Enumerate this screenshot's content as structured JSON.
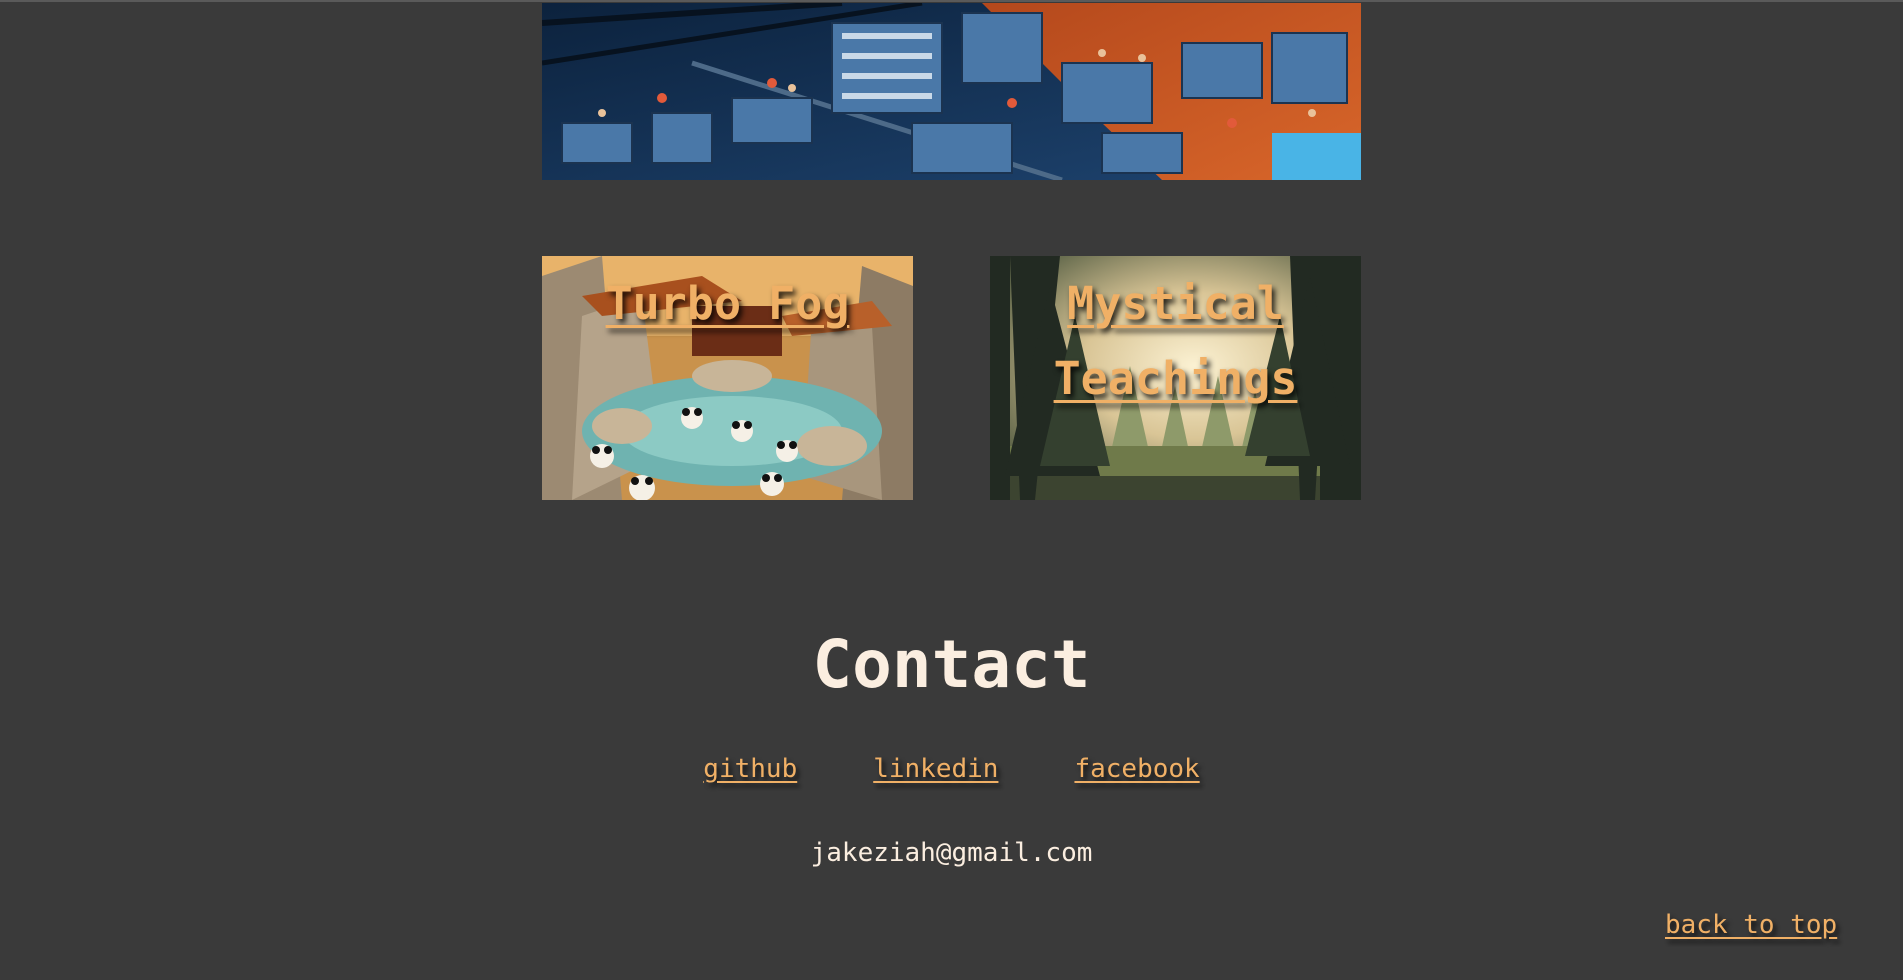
{
  "banner": {
    "image": "isometric-pixel-office-artwork"
  },
  "projects": [
    {
      "title": "Turbo Fog",
      "image": "panda-hot-springs-temple-artwork"
    },
    {
      "title": "Mystical Teachings",
      "image": "sunlit-pine-forest-artwork"
    }
  ],
  "contact": {
    "heading": "Contact",
    "links": [
      "github",
      "linkedin",
      "facebook"
    ],
    "email": "jakeziah@gmail.com"
  },
  "footer": {
    "back_to_top": "back to top"
  },
  "colors": {
    "background": "#3a3a3a",
    "accent": "#f0b066",
    "text": "#fbeee0"
  }
}
